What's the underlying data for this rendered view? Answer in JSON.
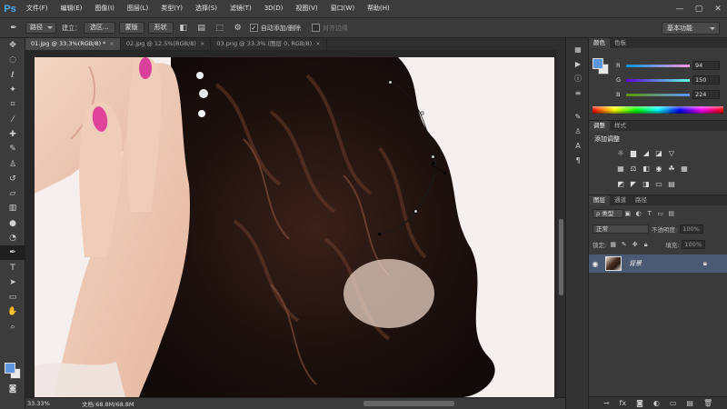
{
  "app": {
    "logo": "Ps"
  },
  "menu": [
    "文件(F)",
    "编辑(E)",
    "图像(I)",
    "图层(L)",
    "类型(Y)",
    "选择(S)",
    "滤镜(T)",
    "3D(D)",
    "视图(V)",
    "窗口(W)",
    "帮助(H)"
  ],
  "window_controls": {
    "minimize": "—",
    "maximize": "▢",
    "close": "✕"
  },
  "options": {
    "tool_icon": "pen-icon",
    "mode": "路径",
    "make_label": "建立：",
    "selection_btn": "选区...",
    "mask_btn": "蒙版",
    "shape_btn": "形状",
    "auto_add_delete": "自动添加/删除",
    "align_edges": "对齐边缘",
    "workspace": "基本功能"
  },
  "document_tabs": [
    {
      "label": "01.jpg @ 33.3%(RGB/8) *",
      "active": true
    },
    {
      "label": "02.jpg @ 12.5%(RGB/8)",
      "active": false
    },
    {
      "label": "03.png @ 33.3% (图层 0, RGB/8)",
      "active": false
    }
  ],
  "status": {
    "zoom": "33.33%",
    "doc_info": "文档:68.8M/68.8M"
  },
  "color_panel": {
    "tabs": [
      "颜色",
      "色板"
    ],
    "fg_color": "#5e96e0",
    "bg_color": "#e8e8e8",
    "r_label": "R",
    "r": "94",
    "g_label": "G",
    "g": "150",
    "b_label": "B",
    "b": "224"
  },
  "adjust_panel": {
    "tabs": [
      "调整",
      "样式"
    ],
    "title": "添加调整"
  },
  "layers_panel": {
    "tabs": [
      "图层",
      "通道",
      "路径"
    ],
    "kind_filter": "ρ 类型",
    "blend_mode": "正常",
    "opacity_label": "不透明度:",
    "opacity": "100%",
    "lock_label": "锁定:",
    "fill_label": "填充:",
    "fill": "100%",
    "layer_name": "背景"
  }
}
